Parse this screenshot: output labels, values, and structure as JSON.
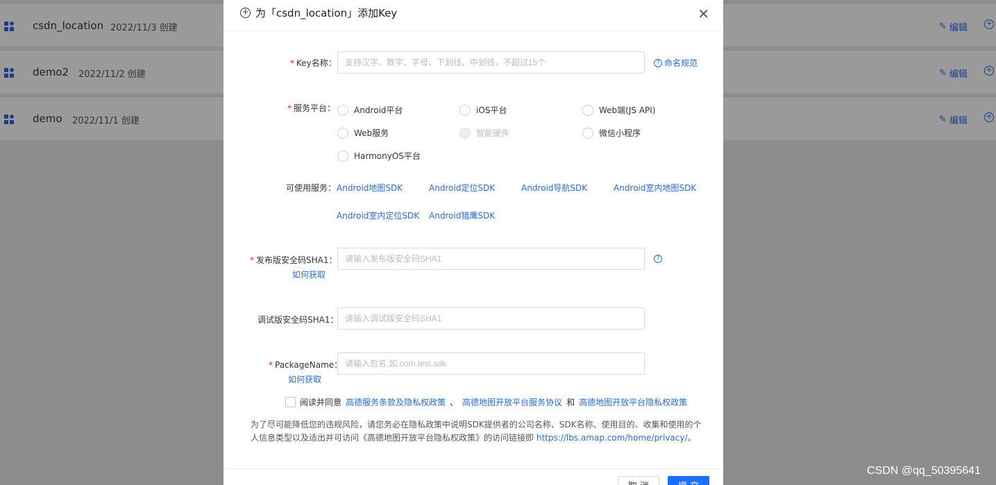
{
  "background_list": [
    {
      "name": "csdn_location",
      "date": "2022/11/3 创建",
      "edit": "编辑"
    },
    {
      "name": "demo2",
      "date": "2022/11/2 创建",
      "edit": "编辑"
    },
    {
      "name": "demo",
      "date": "2022/11/1 创建",
      "edit": "编辑"
    }
  ],
  "modal": {
    "title": "为「csdn_location」添加Key",
    "key_name": {
      "label": "Key名称：",
      "placeholder": "支持汉字、数字、字母、下划线、中划线，不超过15个",
      "help_link": "命名规范"
    },
    "platform": {
      "label": "服务平台：",
      "options": [
        {
          "label": "Android平台",
          "disabled": false
        },
        {
          "label": "iOS平台",
          "disabled": false
        },
        {
          "label": "Web端(JS API)",
          "disabled": false
        },
        {
          "label": "Web服务",
          "disabled": false
        },
        {
          "label": "智能硬件",
          "disabled": true
        },
        {
          "label": "微信小程序",
          "disabled": false
        },
        {
          "label": "HarmonyOS平台",
          "disabled": false
        }
      ]
    },
    "services": {
      "label": "可使用服务：",
      "items": [
        "Android地图SDK",
        "Android定位SDK",
        "Android导航SDK",
        "Android室内地图SDK",
        "Android室内定位SDK",
        "Android猎鹰SDK"
      ]
    },
    "release_sha1": {
      "label": "发布版安全码SHA1：",
      "how_to": "如何获取",
      "placeholder": "请输入发布版安全码SHA1"
    },
    "debug_sha1": {
      "label": "调试版安全码SHA1：",
      "placeholder": "请输入调试版安全码SHA1"
    },
    "package_name": {
      "label": "PackageName：",
      "how_to": "如何获取",
      "placeholder": "请输入包名,如:com.test.sdk"
    },
    "agreement": {
      "prefix": "阅读并同意",
      "link1": "高德服务条款及隐私权政策",
      "sep": "、",
      "link2": "高德地图开放平台服务协议",
      "and": "和",
      "link3": "高德地图开放平台隐私权政策"
    },
    "notice_text": "为了尽可能降低您的违规风险，请您务必在隐私政策中说明SDK提供者的公司名称、SDK名称、使用目的、收集和使用的个人信息类型以及适出并可访问《高德地图开放平台隐私权政策》的访问链接即",
    "notice_link": "https://lbs.amap.com/home/privacy/",
    "notice_end": "。",
    "cancel_label": "取 消",
    "submit_label": "提 交"
  },
  "watermark": "CSDN @qq_50395641"
}
